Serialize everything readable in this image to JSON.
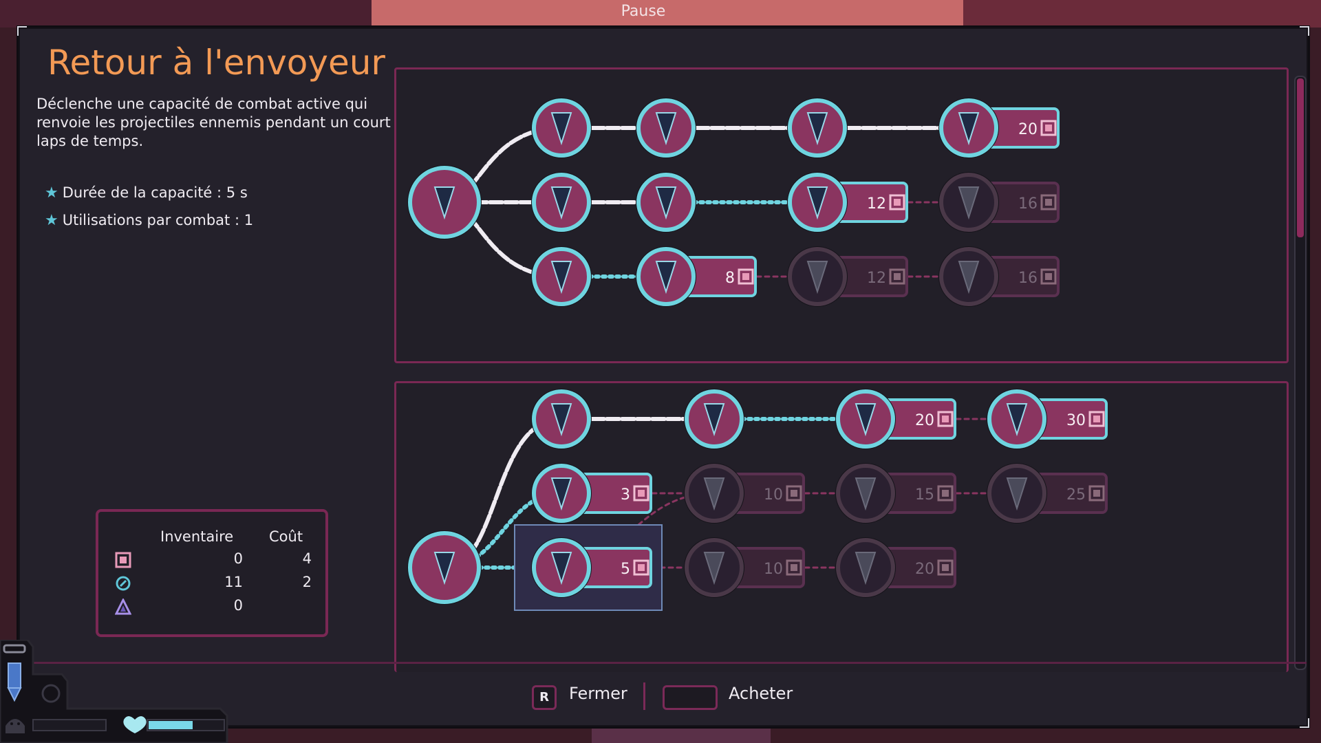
{
  "header": {
    "pause_label": "Pause"
  },
  "detail": {
    "title": "Retour à l'envoyeur",
    "description": "Déclenche une capacité de combat active qui renvoie les projectiles ennemis pendant un court laps de temps.",
    "stats": [
      "Durée de la capacité : 5 s",
      "Utilisations par combat : 1"
    ]
  },
  "inventory": {
    "headers": {
      "inventory": "Inventaire",
      "cost": "Coût"
    },
    "rows": [
      {
        "icon": "square-currency-icon",
        "inventory": "0",
        "cost": "4"
      },
      {
        "icon": "compass-currency-icon",
        "inventory": "11",
        "cost": "2"
      },
      {
        "icon": "triangle-currency-icon",
        "inventory": "0",
        "cost": ""
      }
    ]
  },
  "tree1": {
    "rows": [
      {
        "costs": [
          "",
          "",
          "",
          "20"
        ]
      },
      {
        "costs": [
          "",
          "",
          "12",
          "16"
        ]
      },
      {
        "costs": [
          "",
          "8",
          "12",
          "16"
        ]
      }
    ]
  },
  "tree2": {
    "rows": [
      {
        "costs": [
          "",
          "",
          "20",
          "30"
        ]
      },
      {
        "costs": [
          "3",
          "10",
          "15",
          "25"
        ]
      },
      {
        "costs": [
          "5",
          "10",
          "20"
        ]
      }
    ]
  },
  "footer": {
    "close_key": "R",
    "close_label": "Fermer",
    "buy_label": "Acheter"
  },
  "colors": {
    "accent_orange": "#f39a55",
    "frame_magenta": "#7a2854",
    "node_fill": "#8a3560",
    "node_ring": "#5fc6d8",
    "panel_bg": "#24212b"
  },
  "scroll": {
    "position_fraction": 0.0,
    "visible_fraction": 0.27
  }
}
